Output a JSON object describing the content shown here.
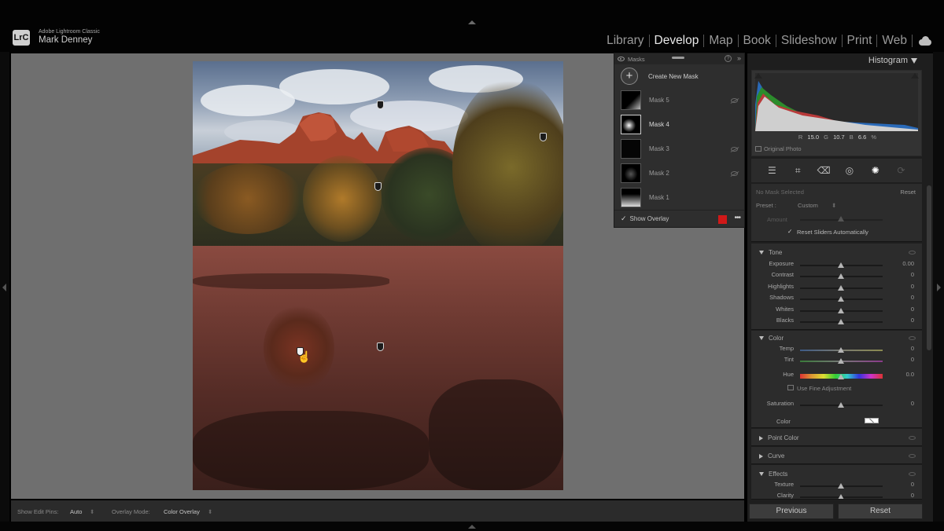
{
  "header": {
    "app_name": "Adobe Lightroom Classic",
    "user_name": "Mark Denney",
    "logo_text": "LrC",
    "modules": [
      "Library",
      "Develop",
      "Map",
      "Book",
      "Slideshow",
      "Print",
      "Web"
    ],
    "active_module": "Develop"
  },
  "masks_panel": {
    "title": "Masks",
    "create_label": "Create New Mask",
    "masks": [
      {
        "label": "Mask 5",
        "hidden": true
      },
      {
        "label": "Mask 4",
        "selected": true
      },
      {
        "label": "Mask 3",
        "hidden": true
      },
      {
        "label": "Mask 2",
        "hidden": true
      },
      {
        "label": "Mask 1"
      }
    ],
    "show_overlay_label": "Show Overlay",
    "overlay_color": "#d01818"
  },
  "histogram": {
    "title": "Histogram",
    "r_label": "R",
    "r_value": "15.0",
    "g_label": "G",
    "g_value": "10.7",
    "b_label": "B",
    "b_value": "6.6",
    "unit": "%",
    "original_photo_label": "Original Photo"
  },
  "mask_settings": {
    "no_mask_label": "No Mask Selected",
    "reset_label": "Reset",
    "preset_label": "Preset :",
    "preset_value": "Custom",
    "amount_label": "Amount",
    "reset_sliders_label": "Reset Sliders Automatically"
  },
  "tone": {
    "title": "Tone",
    "sliders": [
      {
        "label": "Exposure",
        "value": "0.00"
      },
      {
        "label": "Contrast",
        "value": "0"
      },
      {
        "label": "Highlights",
        "value": "0"
      },
      {
        "label": "Shadows",
        "value": "0"
      },
      {
        "label": "Whites",
        "value": "0"
      },
      {
        "label": "Blacks",
        "value": "0"
      }
    ]
  },
  "color": {
    "title": "Color",
    "temp": {
      "label": "Temp",
      "value": "0"
    },
    "tint": {
      "label": "Tint",
      "value": "0"
    },
    "hue": {
      "label": "Hue",
      "value": "0.0"
    },
    "fine_label": "Use Fine Adjustment",
    "saturation": {
      "label": "Saturation",
      "value": "0"
    },
    "color_label": "Color"
  },
  "collapsed_sections": [
    "Point Color",
    "Curve"
  ],
  "effects": {
    "title": "Effects",
    "texture": {
      "label": "Texture",
      "value": "0"
    },
    "clarity": {
      "label": "Clarity",
      "value": "0"
    }
  },
  "bottom_bar": {
    "edit_pins_label": "Show Edit Pins:",
    "edit_pins_value": "Auto",
    "overlay_mode_label": "Overlay Mode:",
    "overlay_mode_value": "Color Overlay"
  },
  "buttons": {
    "previous": "Previous",
    "reset": "Reset"
  }
}
